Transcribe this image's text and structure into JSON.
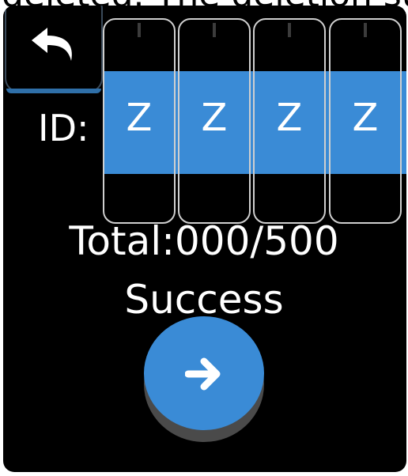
{
  "caption_text": "deleted. The deletion succe",
  "back_button": {
    "icon": "back-arrow-icon"
  },
  "id_label": "ID:",
  "id_chars": [
    "Z",
    "Z",
    "Z",
    "Z"
  ],
  "total_text": "Total:000/500",
  "status_text": "Success",
  "next_button": {
    "icon": "right-arrow-icon"
  },
  "colors": {
    "accent": "#3a8bd6",
    "background": "#000000",
    "text": "#ffffff",
    "roller_border": "#cfcfcf"
  }
}
